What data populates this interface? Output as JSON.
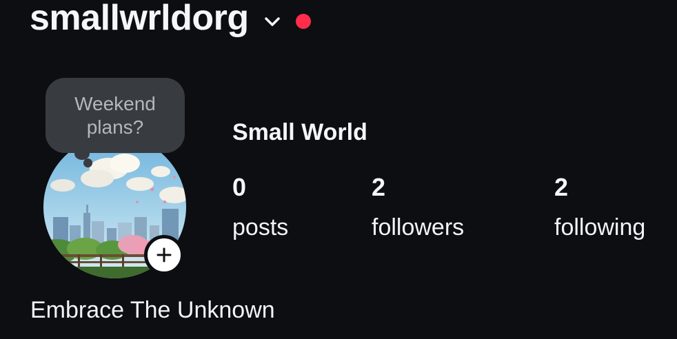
{
  "header": {
    "username": "smallwrldorg",
    "switch_account_icon": "chevron-down-icon",
    "notification_dot_color": "#ff2d4b"
  },
  "note": {
    "text": "Weekend plans?"
  },
  "avatar": {
    "description_icon": "avatar-image",
    "add_story_icon": "plus-icon"
  },
  "profile": {
    "display_name": "Small World",
    "bio": "Embrace The Unknown"
  },
  "stats": {
    "posts": {
      "count": "0",
      "label": "posts"
    },
    "followers": {
      "count": "2",
      "label": "followers"
    },
    "following": {
      "count": "2",
      "label": "following"
    }
  },
  "colors": {
    "background": "#0c0e12",
    "text": "#f5f6f8",
    "note_bubble": "#383b40",
    "note_text": "#b4b8bd"
  }
}
